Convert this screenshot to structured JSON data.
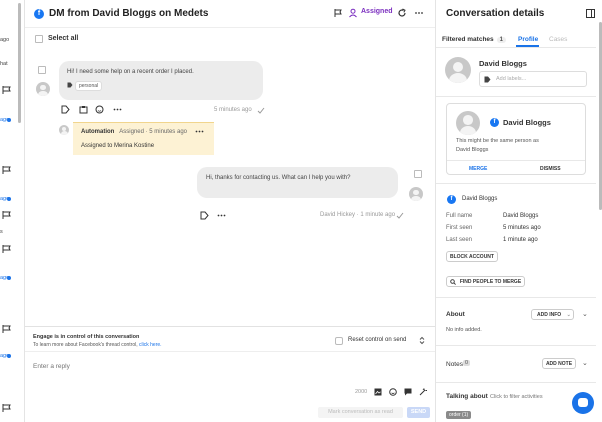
{
  "left_strip": {
    "fragments": [
      "ago",
      "hat",
      "ago",
      "ago",
      "s",
      "ago",
      "ago",
      "ago",
      "ago"
    ]
  },
  "header": {
    "title": "DM from David Bloggs on Medets",
    "assigned_label": "Assigned"
  },
  "select_all_label": "Select all",
  "messages": {
    "incoming": {
      "text": "Hi! I need some help on a recent order I placed.",
      "tag": "personal",
      "time": "5 minutes ago"
    },
    "automation": {
      "title": "Automation",
      "subtitle": "Assigned · 5 minutes ago",
      "body": "Assigned to Merina Kostine"
    },
    "outgoing": {
      "text": "Hi, thanks for contacting us. What can I help you with?",
      "author_time": "David Hickey · 1 minute ago"
    }
  },
  "composer": {
    "engage_title": "Engage is in control of this conversation",
    "learn_text": "To learn more about Facebook's thread control,",
    "learn_link": "click here.",
    "reset_label": "Reset control on send",
    "placeholder": "Enter a reply",
    "char_count": "2000",
    "mark_label": "Mark conversation as read",
    "send_label": "SEND"
  },
  "details": {
    "title": "Conversation details",
    "tabs": [
      {
        "label": "Filtered matches",
        "badge": "1"
      },
      {
        "label": "Profile"
      },
      {
        "label": "Cases"
      }
    ],
    "profile_name": "David Bloggs",
    "add_labels_placeholder": "Add labels...",
    "merge_card": {
      "name": "David Bloggs",
      "text_line1": "This might be the same person as",
      "text_line2": "David Bloggs",
      "merge": "MERGE",
      "dismiss": "DISMISS"
    },
    "fb_name": "David Bloggs",
    "fields": [
      {
        "key": "Full name",
        "value": "David Bloggs"
      },
      {
        "key": "First seen",
        "value": "5 minutes ago"
      },
      {
        "key": "Last seen",
        "value": "1 minute ago"
      }
    ],
    "block_account": "BLOCK ACCOUNT",
    "find_people": "FIND PEOPLE TO MERGE",
    "about_title": "About",
    "add_info": "ADD INFO",
    "no_info": "No info added.",
    "notes_title": "Notes",
    "notes_count": "0",
    "add_note": "ADD NOTE",
    "talking_title": "Talking about",
    "talking_hint": "Click to filter activities",
    "talking_chip": "order (1)"
  },
  "colors": {
    "facebook_blue": "#1877f2",
    "accent_purple": "#7b2fbf",
    "link_blue": "#1a73e8",
    "automation_bg": "#fdf2d4"
  }
}
